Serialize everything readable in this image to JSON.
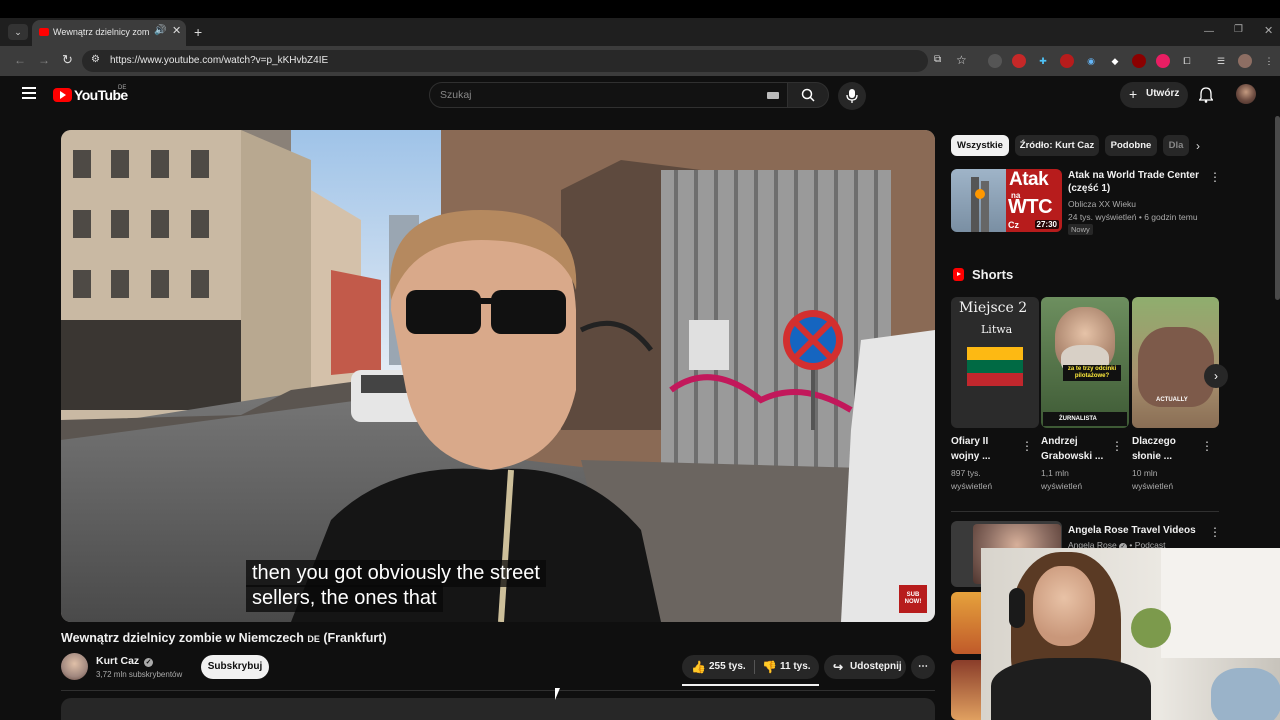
{
  "browser": {
    "tab_title": "Wewnątrz dzielnicy zombie w Niemczech",
    "url": "https://www.youtube.com/watch?v=p_kKHvbZ4IE"
  },
  "yt": {
    "logo_text": "YouTube",
    "region": "DE",
    "search_placeholder": "Szukaj",
    "create_label": "Utwórz"
  },
  "video": {
    "caption_line1": "then you got obviously the street",
    "caption_line2": "sellers, the ones that",
    "title": "Wewnątrz dzielnicy zombie w Niemczech 🇩🇪 (Frankfurt)",
    "title_text": "Wewnątrz dzielnicy zombie w Niemczech",
    "title_flag": "DE",
    "title_suffix": "(Frankfurt)",
    "channel": "Kurt Caz",
    "subscribers": "3,72 mln subskrybentów",
    "subscribe_label": "Subskrybuj",
    "likes": "255 tys.",
    "dislikes": "11 tys.",
    "share_label": "Udostępnij",
    "sign_text": "SUB NOW!"
  },
  "chips": [
    "Wszystkie",
    "Źródło: Kurt Caz",
    "Podobne",
    "Dla"
  ],
  "recommended": {
    "title_line1": "Atak na World Trade Center",
    "title_line2": "(część 1)",
    "channel": "Oblicza XX Wieku",
    "stats": "24 tys. wyświetleń • 6 godzin temu",
    "badge": "Nowy",
    "thumb_text1": "Atak",
    "thumb_text2": "na",
    "thumb_text3": "WTC",
    "thumb_text4": "Cz",
    "duration": "27:30"
  },
  "shorts": {
    "header": "Shorts",
    "items": [
      {
        "title1": "Ofiary II",
        "title2": "wojny ...",
        "views1": "897 tys.",
        "views2": "wyświetleń",
        "thumb_text1": "Miejsce 2",
        "thumb_text2": "Litwa"
      },
      {
        "title1": "Andrzej",
        "title2": "Grabowski ...",
        "views1": "1,1 mln",
        "views2": "wyświetleń",
        "thumb_text1": "za te trzy odcinki pilotażowe?",
        "thumb_text2": "ŻURNALISTA"
      },
      {
        "title1": "Dlaczego",
        "title2": "słonie ...",
        "views1": "10 mln",
        "views2": "wyświetleń",
        "thumb_text1": "ACTUALLY",
        "thumb_text2": ""
      }
    ]
  },
  "podcast": {
    "title": "Angela Rose Travel Videos",
    "channel": "Angela Rose",
    "type": "Podcast"
  },
  "colors": {
    "bg": "#0f0f0f",
    "yt_red": "#ff0000",
    "chip_bg": "#272727",
    "text_secondary": "#aaaaaa"
  }
}
